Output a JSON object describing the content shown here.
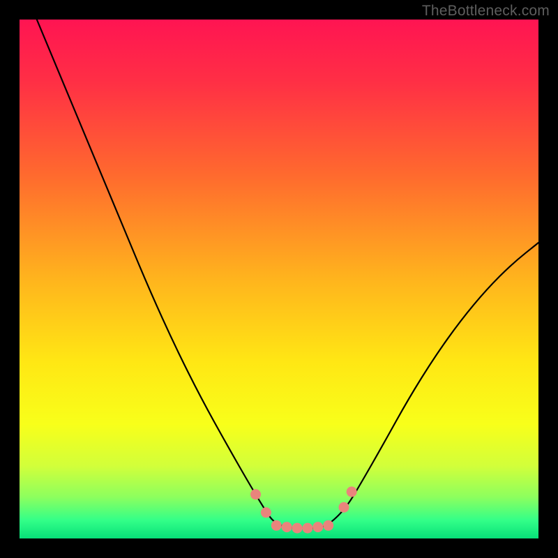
{
  "watermark": "TheBottleneck.com",
  "chart_data": {
    "type": "line",
    "title": "",
    "xlabel": "",
    "ylabel": "",
    "xlim": [
      0,
      100
    ],
    "ylim": [
      0,
      100
    ],
    "description": "Bottleneck percentage curve. Background vertical gradient maps value to color: top (high bottleneck) = red, middle = yellow, bottom (optimal) = green. Black curve shows bottleneck vs. an implicit horizontal axis; minimum plateau near x≈48–60 at y≈1–3 marked with salmon dots.",
    "gradient_stops": [
      {
        "pos": 0.0,
        "color": "#ff1452"
      },
      {
        "pos": 0.12,
        "color": "#ff2f45"
      },
      {
        "pos": 0.3,
        "color": "#ff6a2e"
      },
      {
        "pos": 0.5,
        "color": "#ffb41d"
      },
      {
        "pos": 0.66,
        "color": "#ffe714"
      },
      {
        "pos": 0.78,
        "color": "#f8ff1a"
      },
      {
        "pos": 0.86,
        "color": "#d2ff3a"
      },
      {
        "pos": 0.92,
        "color": "#8dff5e"
      },
      {
        "pos": 0.965,
        "color": "#33ff88"
      },
      {
        "pos": 1.0,
        "color": "#07e079"
      }
    ],
    "series": [
      {
        "name": "bottleneck-curve",
        "x": [
          0,
          5,
          10,
          15,
          20,
          25,
          30,
          35,
          40,
          44,
          47,
          49,
          52,
          55,
          58,
          60,
          63,
          66,
          70,
          75,
          80,
          85,
          90,
          95,
          100
        ],
        "y": [
          108,
          96,
          84,
          72,
          60,
          48,
          37,
          27,
          18,
          11,
          6,
          3,
          2,
          2,
          2,
          3,
          6,
          11,
          18,
          27,
          35,
          42,
          48,
          53,
          57
        ]
      }
    ],
    "markers": {
      "name": "optimal-range-dots",
      "color": "#e9847c",
      "points": [
        {
          "x": 45.5,
          "y": 8.5
        },
        {
          "x": 47.5,
          "y": 5.0
        },
        {
          "x": 49.5,
          "y": 2.5
        },
        {
          "x": 51.5,
          "y": 2.2
        },
        {
          "x": 53.5,
          "y": 2.0
        },
        {
          "x": 55.5,
          "y": 2.0
        },
        {
          "x": 57.5,
          "y": 2.2
        },
        {
          "x": 59.5,
          "y": 2.5
        },
        {
          "x": 62.5,
          "y": 6.0
        },
        {
          "x": 64.0,
          "y": 9.0
        }
      ]
    }
  }
}
